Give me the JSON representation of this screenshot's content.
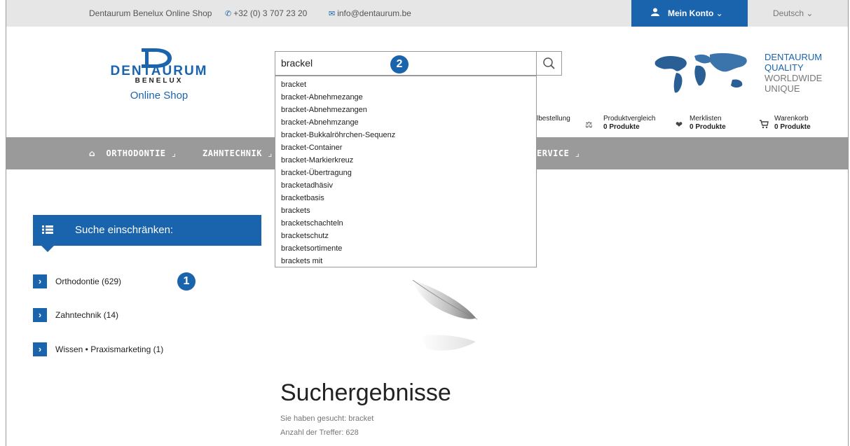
{
  "topbar": {
    "shop_name": "Dentaurum Benelux Online Shop",
    "phone": "+32 (0) 3 707 23 20",
    "email": "info@dentaurum.be",
    "account_label": "Mein Konto",
    "language": "Deutsch"
  },
  "logo": {
    "name": "DENTAURUM",
    "sub": "BENELUX",
    "shop": "Online Shop"
  },
  "search": {
    "value": "brackel",
    "badge": "2"
  },
  "slogan": {
    "line1": "DENTAURUM",
    "line2": "QUALITY",
    "line3": "WORLDWIDE",
    "line4": "UNIQUE"
  },
  "header_links": {
    "quick_order": "lbestellung",
    "compare_label": "Produktvergleich",
    "compare_count": "0 Produkte",
    "wishlist_label": "Merklisten",
    "wishlist_count": "0 Produkte",
    "cart_label": "Warenkorb",
    "cart_count": "0 Produkte"
  },
  "nav": {
    "orthodontie": "ORTHODONTIE",
    "zahntechnik": "ZAHNTECHNIK",
    "service": "ERVICE"
  },
  "suggestions": [
    "bracket",
    "bracket-Abnehmezange",
    "bracket-Abnehmezangen",
    "bracket-Abnehmzange",
    "bracket-Bukkalröhrchen-Sequenz",
    "bracket-Container",
    "bracket-Markierkreuz",
    "bracket-Übertragung",
    "bracketadhäsiv",
    "bracketbasis",
    "brackets",
    "bracketschachteln",
    "bracketschutz",
    "bracketsortimente",
    "brackets mit"
  ],
  "filter": {
    "title": "Suche einschränken:",
    "badge": "1",
    "categories": [
      "Orthodontie (629)",
      "Zahntechnik (14)",
      "Wissen • Praxismarketing (1)"
    ]
  },
  "results": {
    "title": "Suchergebnisse",
    "searched": "Sie haben gesucht: bracket",
    "count": "Anzahl der Treffer: 628"
  },
  "colors": {
    "brand_blue": "#1a64ad",
    "nav_gray": "#9a9a9a",
    "topbar_gray": "#e6e6e6"
  }
}
